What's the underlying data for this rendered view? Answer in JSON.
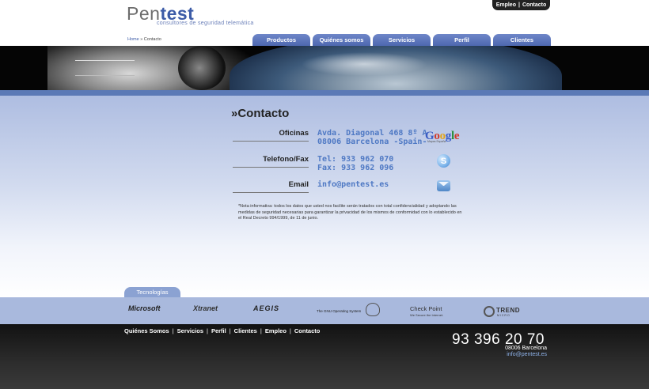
{
  "logo": {
    "pen": "Pen",
    "test": "test",
    "tagline": "consultores de seguridad telemática"
  },
  "top_links": {
    "empleo": "Empleo",
    "separator": "|",
    "contacto": "Contacto"
  },
  "breadcrumb": {
    "home": "Home",
    "separator": "»",
    "current": "Contacto"
  },
  "nav_tabs": [
    "Productos",
    "Quiénes somos",
    "Servicios",
    "Perfil",
    "Clientes"
  ],
  "page_title": "»Contacto",
  "contact": {
    "oficinas_label": "Oficinas",
    "oficinas_line1": "Avda. Diagonal 468 8º A",
    "oficinas_line2": "08006 Barcelona -Spain-",
    "telefono_label": "Telefono/Fax",
    "tel": "Tel: 933 962 070",
    "fax": "Fax: 933 962 096",
    "email_label": "Email",
    "email": "info@pentest.es"
  },
  "icons": {
    "maps": "google-maps-icon",
    "google_sub": "Mapas España",
    "phone": "skype-icon",
    "mail": "mail-icon"
  },
  "legal_note": "*Nota informativa: todos los datos que usted nos facilite serán tratados con total confidencialidad y adoptando las medidas de seguridad necesarias para garantizar la privacidad de los mismos de conformidad con lo establecido en el Real Decreto 994/1999, de 11 de junio.",
  "tecnologias": {
    "tab_label": "Tecnologías",
    "logos": {
      "microsoft": "Microsoft",
      "xtranet": "Xtranet",
      "aegis": "AEGIS",
      "gnu": "The GNU Operating System",
      "checkpoint": "Check Point",
      "checkpoint_sub": "We Secure the Internet.",
      "trend": "TREND",
      "trend_sub": "MICRO"
    }
  },
  "footer": {
    "nav": [
      "Quiénes Somos",
      "Servicios",
      "Perfil",
      "Clientes",
      "Empleo",
      "Contacto"
    ],
    "separator": "|",
    "phone": "93 396 20 70",
    "city": "08006 Barcelona",
    "email": "info@pentest.es"
  },
  "colors": {
    "accent": "#3c5ba7",
    "tab_blue": "#5b79b6",
    "link_blue": "#4f79c4",
    "footer_dark": "#1e1e1e"
  }
}
